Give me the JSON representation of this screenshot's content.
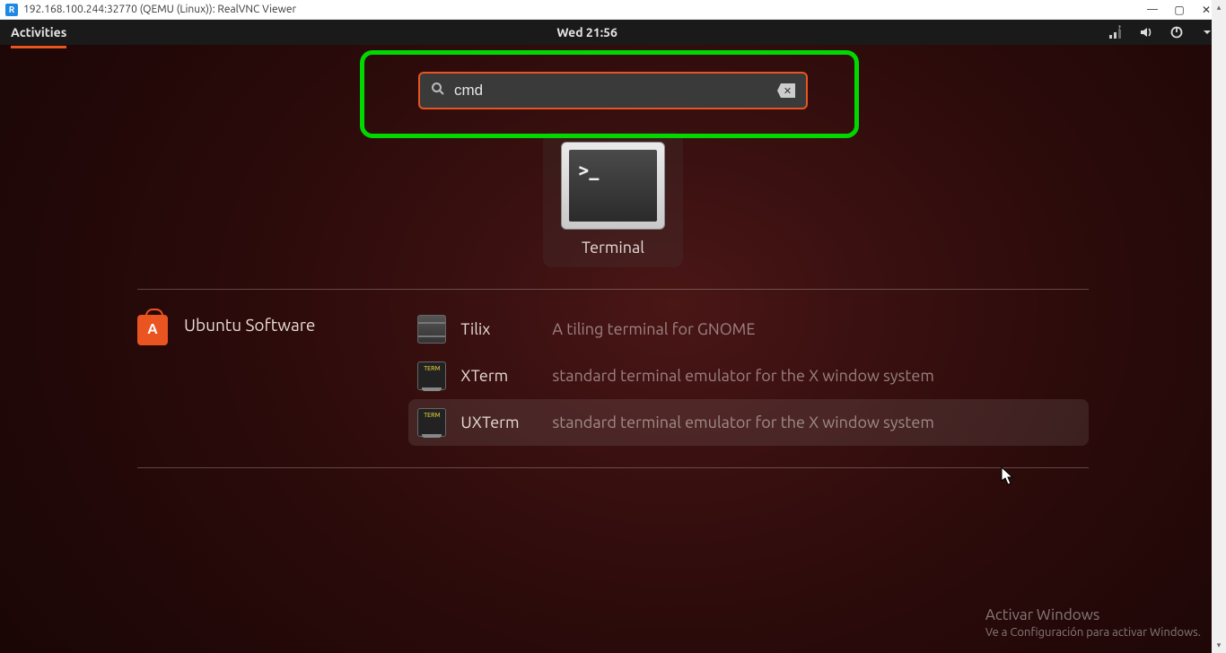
{
  "window": {
    "app_icon_text": "R",
    "title": "192.168.100.244:32770 (QEMU (Linux)): RealVNC Viewer"
  },
  "topbar": {
    "activities": "Activities",
    "clock": "Wed 21:56"
  },
  "search": {
    "query": "cmd",
    "clear_symbol": "✕"
  },
  "result": {
    "prompt": ">_",
    "label": "Terminal"
  },
  "software": {
    "section_label": "Ubuntu Software",
    "rows": [
      {
        "name": "Tilix",
        "desc": "A tiling terminal for GNOME"
      },
      {
        "name": "XTerm",
        "desc": "standard terminal emulator for the X window system"
      },
      {
        "name": "UXTerm",
        "desc": "standard terminal emulator for the X window system"
      }
    ]
  },
  "watermark": {
    "title": "Activar Windows",
    "sub": "Ve a Configuración para activar Windows."
  }
}
